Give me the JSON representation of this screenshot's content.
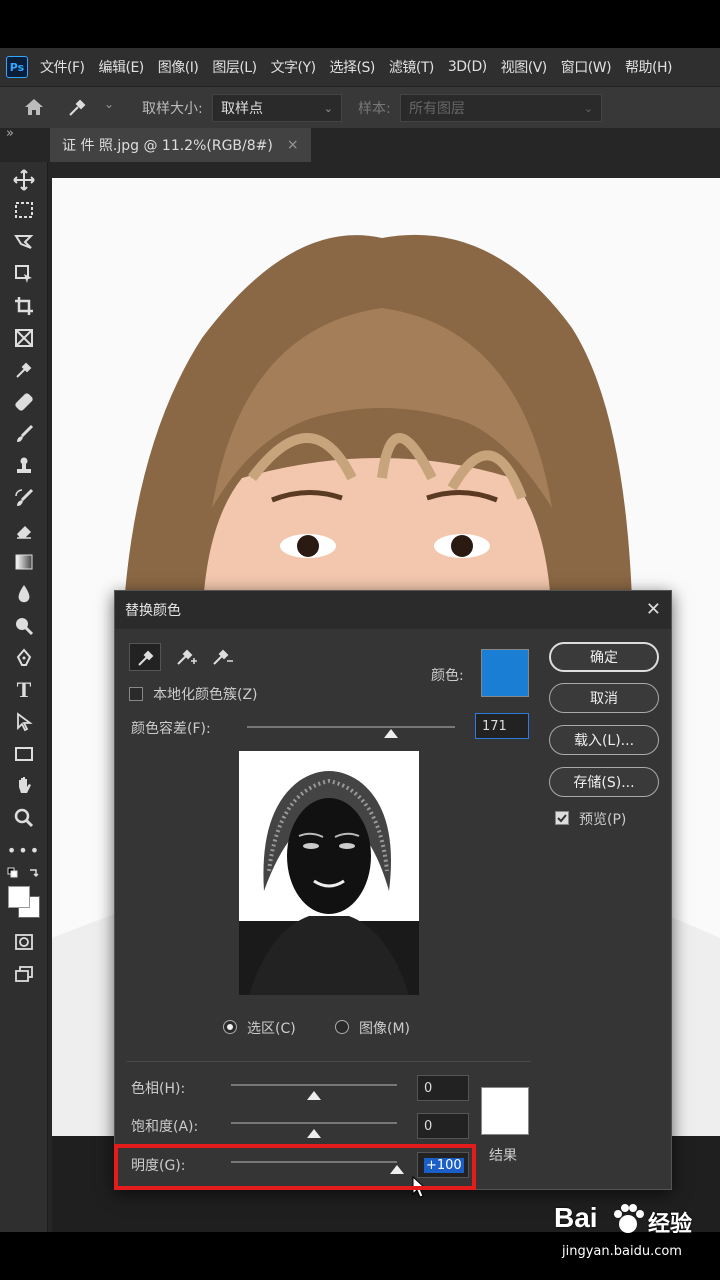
{
  "app": {
    "logo": "Ps",
    "menu": [
      "文件(F)",
      "编辑(E)",
      "图像(I)",
      "图层(L)",
      "文字(Y)",
      "选择(S)",
      "滤镜(T)",
      "3D(D)",
      "视图(V)",
      "窗口(W)",
      "帮助(H)"
    ]
  },
  "options": {
    "sample_size_label": "取样大小:",
    "sample_size_value": "取样点",
    "sample_label": "样本:",
    "sample_value": "所有图层"
  },
  "tab": {
    "collapse_glyph": "»",
    "title": "证 件 照.jpg @ 11.2%(RGB/8#)",
    "close": "×"
  },
  "dialog": {
    "title": "替换颜色",
    "close": "✕",
    "color_label": "颜色:",
    "color_swatch": "#1a7fd4",
    "localized_label": "本地化颜色簇(Z)",
    "localized_checked": false,
    "fuzziness_label": "颜色容差(F):",
    "fuzziness_value": "171",
    "fuzziness_level": 0.69,
    "selection_label": "选区(C)",
    "image_label": "图像(M)",
    "selected_mode": "selection",
    "hue_label": "色相(H):",
    "hue_value": "0",
    "hue_level": 0.5,
    "saturation_label": "饱和度(A):",
    "saturation_value": "0",
    "saturation_level": 0.5,
    "lightness_label": "明度(G):",
    "lightness_value": "+100",
    "lightness_level": 1.0,
    "result_label": "结果",
    "result_color": "#ffffff",
    "buttons": {
      "ok": "确定",
      "cancel": "取消",
      "load": "载入(L)...",
      "save": "存储(S)...",
      "preview": "预览(P)"
    },
    "preview_checked": true
  },
  "watermark": {
    "brand": "Bai",
    "brand2": "经验",
    "url": "jingyan.baidu.com"
  },
  "colors": {
    "highlight": "#e51c1c",
    "accent": "#31a8ff"
  }
}
